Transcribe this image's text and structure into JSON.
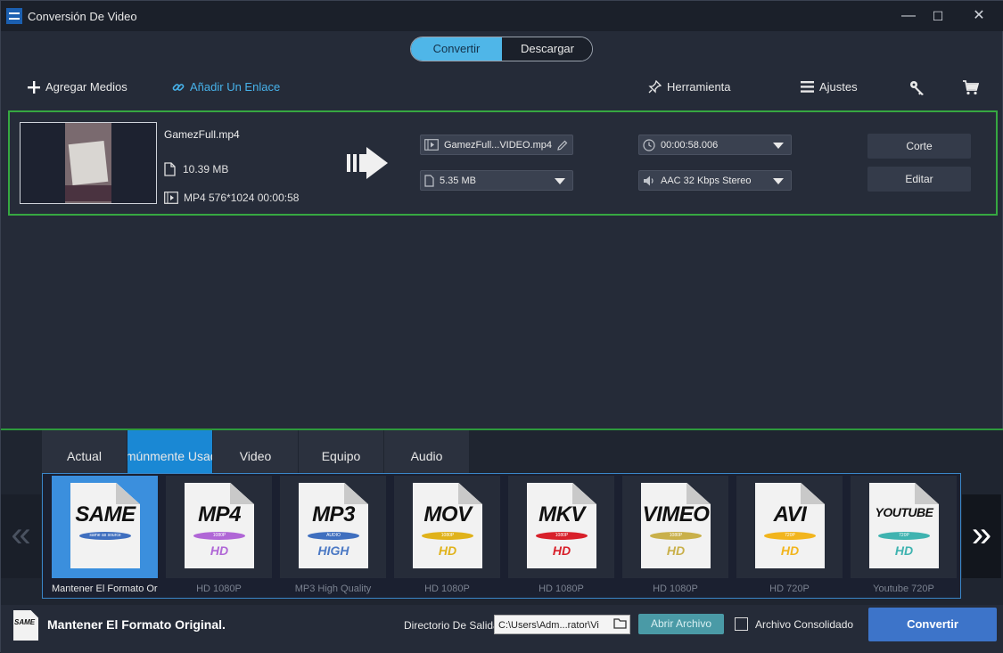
{
  "window": {
    "title": "Conversión De Video",
    "minimize": "—",
    "maximize": "☐",
    "close": "✕"
  },
  "mode_tabs": {
    "convert": "Convertir",
    "download": "Descargar",
    "active": "convert"
  },
  "toolbar": {
    "add_media": "Agregar Medios",
    "add_link": "Añadir Un Enlace",
    "tool": "Herramienta",
    "settings": "Ajustes"
  },
  "file": {
    "name": "GamezFull.mp4",
    "size": "10.39 MB",
    "meta": "MP4 576*1024 00:00:58",
    "output_name": "GamezFull...VIDEO.mp4",
    "output_size": "5.35 MB",
    "duration": "00:00:58.006",
    "audio": "AAC 32 Kbps Stereo",
    "trim_label": "Corte",
    "edit_label": "Editar"
  },
  "format_tabs": [
    "Actual",
    "Comúnmente Usado",
    "Video",
    "Equipo",
    "Audio"
  ],
  "format_tabs_active": 1,
  "formats": [
    {
      "title": "SAME",
      "pill": "same as source",
      "pill_color": "#3f6fbf",
      "sub": "",
      "sub_color": "#3f6fbf",
      "label": "Mantener El Formato Original"
    },
    {
      "title": "MP4",
      "pill": "1080P",
      "pill_color": "#b066d6",
      "sub": "HD",
      "sub_color": "#b066d6",
      "label": "HD 1080P"
    },
    {
      "title": "MP3",
      "pill": "AUDIO",
      "pill_color": "#3f6fbf",
      "sub": "HIGH",
      "sub_color": "#4a78c4",
      "label": "MP3 High Quality"
    },
    {
      "title": "MOV",
      "pill": "1080P",
      "pill_color": "#e0b21a",
      "sub": "HD",
      "sub_color": "#e0b21a",
      "label": "HD 1080P"
    },
    {
      "title": "MKV",
      "pill": "1080P",
      "pill_color": "#d8202a",
      "sub": "HD",
      "sub_color": "#d8202a",
      "label": "HD 1080P"
    },
    {
      "title": "VIMEO",
      "pill": "1080P",
      "pill_color": "#c9b04a",
      "sub": "HD",
      "sub_color": "#c9b04a",
      "label": "HD 1080P"
    },
    {
      "title": "AVI",
      "pill": "720P",
      "pill_color": "#f2b51d",
      "sub": "HD",
      "sub_color": "#f2b51d",
      "label": "HD 720P"
    },
    {
      "title": "YOUTUBE",
      "pill": "720P",
      "pill_color": "#3fb3b0",
      "sub": "HD",
      "sub_color": "#3fb3b0",
      "label": "Youtube 720P"
    }
  ],
  "bottom": {
    "format_icon": "SAME",
    "format_label": "Mantener El Formato Original.",
    "output_dir_label": "Directorio De Salida",
    "output_dir_value": "C:\\Users\\Adm...rator\\Vi",
    "open_folder": "Abrir Archivo",
    "merge_label": "Archivo Consolidado",
    "convert": "Convertir"
  },
  "colors": {
    "accent": "#4fb6e8",
    "selection_green": "#36a841",
    "convert_button": "#3d74c9"
  }
}
